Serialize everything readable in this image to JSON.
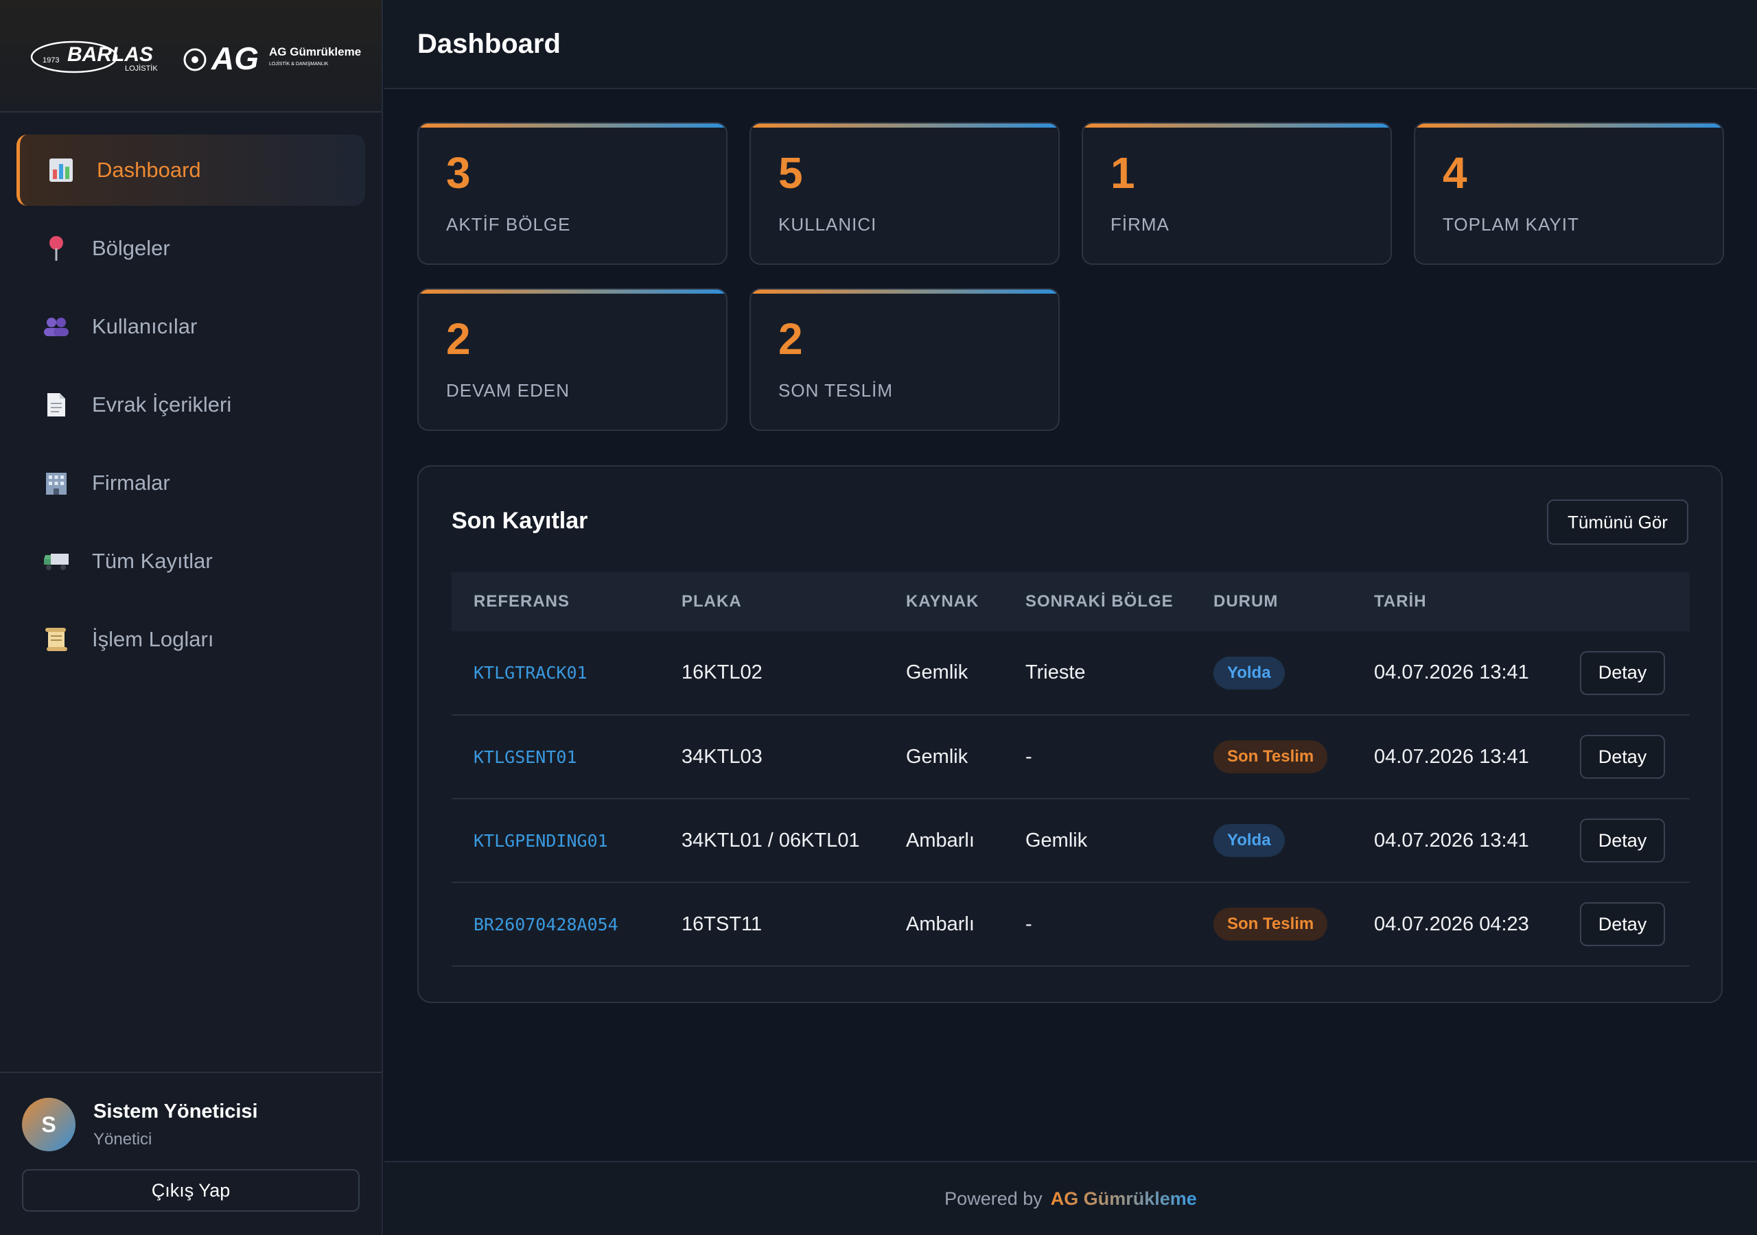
{
  "logo": {
    "year": "1973",
    "brand1": "BARLAS",
    "brand1_sub": "LOJİSTİK",
    "brand2_mark": "AG",
    "brand2": "AG Gümrükleme",
    "brand2_sub": "LOJİSTİK & DANIŞMANLIK"
  },
  "sidebar": {
    "items": [
      {
        "label": "Dashboard",
        "icon": "bar-chart-icon",
        "active": true
      },
      {
        "label": "Bölgeler",
        "icon": "pin-icon"
      },
      {
        "label": "Kullanıcılar",
        "icon": "users-icon"
      },
      {
        "label": "Evrak İçerikleri",
        "icon": "document-icon"
      },
      {
        "label": "Firmalar",
        "icon": "building-icon"
      },
      {
        "label": "Tüm Kayıtlar",
        "icon": "truck-icon"
      },
      {
        "label": "İşlem Logları",
        "icon": "scroll-icon"
      }
    ]
  },
  "user": {
    "initial": "S",
    "name": "Sistem Yöneticisi",
    "role": "Yönetici",
    "logout": "Çıkış Yap"
  },
  "header": {
    "title": "Dashboard"
  },
  "stats": [
    {
      "value": "3",
      "label": "AKTİF BÖLGE"
    },
    {
      "value": "5",
      "label": "KULLANICI"
    },
    {
      "value": "1",
      "label": "FİRMA"
    },
    {
      "value": "4",
      "label": "TOPLAM KAYIT"
    },
    {
      "value": "2",
      "label": "DEVAM EDEN"
    },
    {
      "value": "2",
      "label": "SON TESLİM"
    }
  ],
  "recent": {
    "title": "Son Kayıtlar",
    "view_all": "Tümünü Gör",
    "columns": [
      "REFERANS",
      "PLAKA",
      "KAYNAK",
      "SONRAKİ BÖLGE",
      "DURUM",
      "TARİH"
    ],
    "rows": [
      {
        "ref": "KTLGTRACK01",
        "plate": "16KTL02",
        "source": "Gemlik",
        "next": "Trieste",
        "status": "Yolda",
        "status_color": "#4ba3f0",
        "date": "04.07.2026 13:41",
        "action": "Detay"
      },
      {
        "ref": "KTLGSENT01",
        "plate": "34KTL03",
        "source": "Gemlik",
        "next": "-",
        "status": "Son Teslim",
        "status_color": "#ee8a32",
        "date": "04.07.2026 13:41",
        "action": "Detay"
      },
      {
        "ref": "KTLGPENDING01",
        "plate": "34KTL01 / 06KTL01",
        "source": "Ambarlı",
        "next": "Gemlik",
        "status": "Yolda",
        "status_color": "#4ba3f0",
        "date": "04.07.2026 13:41",
        "action": "Detay"
      },
      {
        "ref": "BR26070428A054",
        "plate": "16TST11",
        "source": "Ambarlı",
        "next": "-",
        "status": "Son Teslim",
        "status_color": "#ee8a32",
        "date": "04.07.2026 04:23",
        "action": "Detay"
      }
    ]
  },
  "footer": {
    "prefix": "Powered by",
    "brand": "AG Gümrükleme"
  },
  "colors": {
    "accent": "#ee8a32",
    "blue": "#3a9ae0",
    "background": "#111722"
  }
}
